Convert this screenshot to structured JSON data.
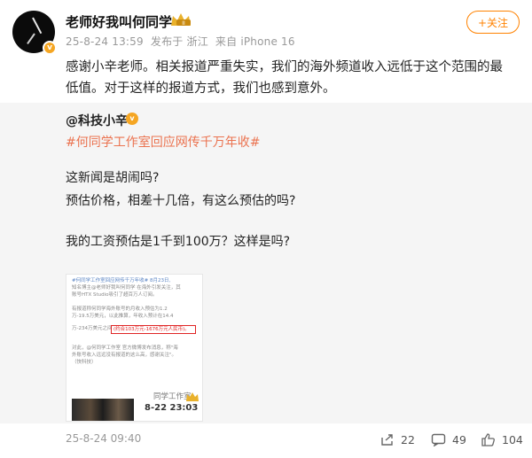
{
  "post": {
    "username": "老师好我叫何同学",
    "vip_badge": "II",
    "time": "25-8-24 13:59",
    "location": "发布于 浙江",
    "device": "来自 iPhone 16",
    "follow_label": "+关注",
    "text": "感谢小辛老师。相关报道严重失实，我们的海外频道收入远低于这个范围的最低值。对于这样的报道方式，我们也感到意外。"
  },
  "repost": {
    "author": "@科技小辛",
    "hashtag": "#何同学工作室回应网传千万年收#",
    "lines": [
      "这新闻是胡闹吗?",
      "预估价格，相差十几倍，有这么预估的吗?",
      "我的工资预估是1千到100万？这样是吗?"
    ],
    "image": {
      "line1": "#何同学工作室回应网传千万年收# 8月23日,",
      "line2": "知名博主@老师好我叫何同学 在海外引发关注，其",
      "line3": "账号HTX Studio吸引了超百万人订阅。",
      "line4": "有报道称何同学海外账号的月收入预估为1.2",
      "line5": "万-19.5万美元，以此推算，年收入预计在14.4",
      "line6": "万-234万美元之间",
      "highlight": "(约合103万元-1676万元人民币)。",
      "line8": "对此，@何同学工作室 官方微博发布消息，称\"海",
      "line9": "外账号收入远远没有报道的这么高，感谢关注\"。",
      "line10": "（快科技）",
      "studio": "同学工作室",
      "timestamp": "8-22 23:03"
    }
  },
  "footer": {
    "time": "25-8-24 09:40",
    "reposts": "22",
    "comments": "49",
    "likes": "104"
  },
  "colors": {
    "accent": "#ff8200",
    "hashtag": "#eb7350",
    "repost_bg": "#f5f5f5"
  },
  "icons": [
    "crown-icon",
    "verified-badge-icon",
    "repost-icon",
    "comment-icon",
    "like-icon"
  ]
}
